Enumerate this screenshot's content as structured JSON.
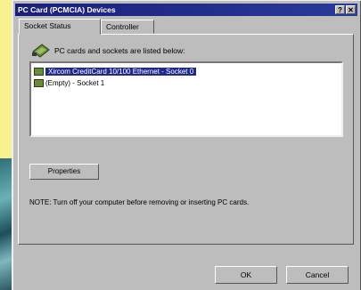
{
  "window": {
    "title": "PC Card (PCMCIA) Devices",
    "help_glyph": "?",
    "close_glyph": "✕"
  },
  "tabs": [
    {
      "label": "Socket Status"
    },
    {
      "label": "Controller"
    }
  ],
  "socket_panel": {
    "intro": "PC cards and sockets are listed below:",
    "list_items": [
      {
        "label": "Xircom CreditCard 10/100 Ethernet - Socket 0",
        "selected": true
      },
      {
        "label": "(Empty) - Socket 1",
        "selected": false
      }
    ],
    "properties_label": "Properties",
    "note": "NOTE: Turn off your computer before removing or inserting PC cards."
  },
  "buttons": {
    "ok_label": "OK",
    "cancel_label": "Cancel"
  },
  "icons": [
    "pc-card-icon",
    "socket-icon",
    "help-icon",
    "close-icon"
  ]
}
